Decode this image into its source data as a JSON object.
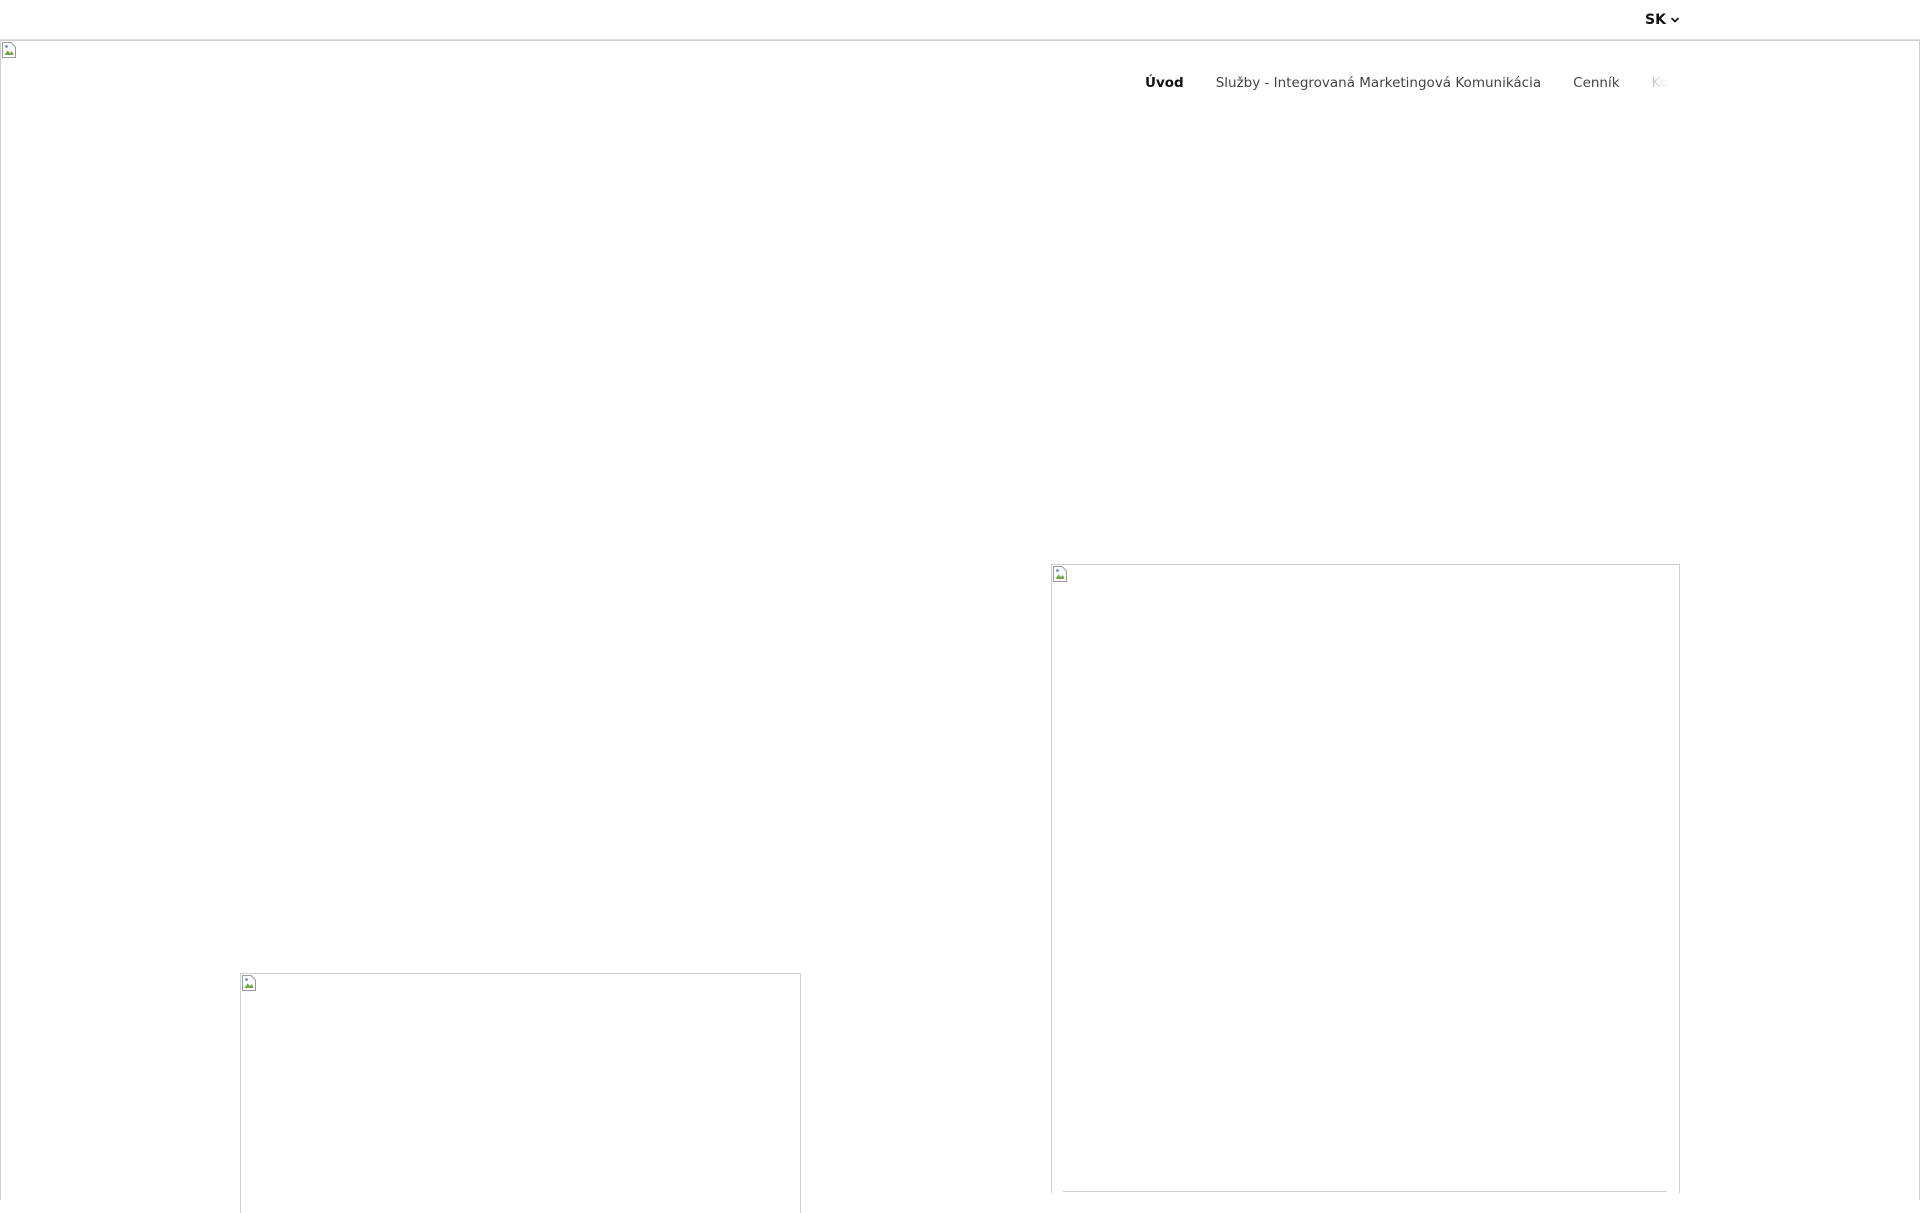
{
  "language_switcher": {
    "current": "SK",
    "chevron_icon": "chevron-down-icon"
  },
  "nav": {
    "items": [
      {
        "label": "Úvod",
        "active": true
      },
      {
        "label": "Služby - Integrovaná Marketingová Komunikácia",
        "active": false
      },
      {
        "label": "Cenník",
        "active": false
      },
      {
        "label": "Kontakt",
        "active": false
      }
    ]
  },
  "images": {
    "icon": "broken-image-icon"
  },
  "colors": {
    "text_active": "#111111",
    "text_nav": "#444444",
    "border": "#cfcfcf",
    "background": "#ffffff"
  }
}
